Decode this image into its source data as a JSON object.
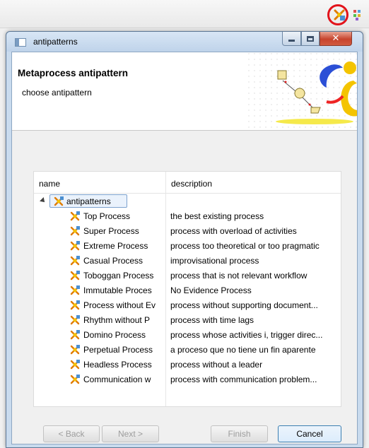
{
  "dialog": {
    "title": "antipatterns",
    "banner_title": "Metaprocess antipattern",
    "banner_subtitle": "choose antipattern"
  },
  "table": {
    "columns": [
      "name",
      "description"
    ],
    "root": "antipatterns",
    "rows": [
      {
        "name": "Top Process",
        "description": "the best existing process"
      },
      {
        "name": "Super Process",
        "description": "process with overload of activities"
      },
      {
        "name": "Extreme Process",
        "description": "process too theoretical or too pragmatic"
      },
      {
        "name": "Casual Process",
        "description": "improvisational process"
      },
      {
        "name": "Toboggan Process",
        "description": "process that is not relevant workflow"
      },
      {
        "name": "Immutable Proces",
        "description": "No Evidence Process"
      },
      {
        "name": "Process without Ev",
        "description": "process without supporting document..."
      },
      {
        "name": "Rhythm  without P",
        "description": "process with time lags"
      },
      {
        "name": "Domino Process",
        "description": "process whose activities i, trigger direc..."
      },
      {
        "name": "Perpetual Process",
        "description": "a proceso que no tiene un fin aparente"
      },
      {
        "name": "Headless Process",
        "description": "process without a leader"
      },
      {
        "name": "Communication w",
        "description": "process with communication problem..."
      }
    ]
  },
  "buttons": {
    "back": "< Back",
    "next": "Next >",
    "finish": "Finish",
    "cancel": "Cancel"
  },
  "icons": {
    "toolbar": [
      "antipattern-tool-icon",
      "grid-tool-icon"
    ],
    "row": "antipattern-icon"
  },
  "colors": {
    "highlight_circle": "#e2131b",
    "selection_border": "#7da2ce"
  }
}
